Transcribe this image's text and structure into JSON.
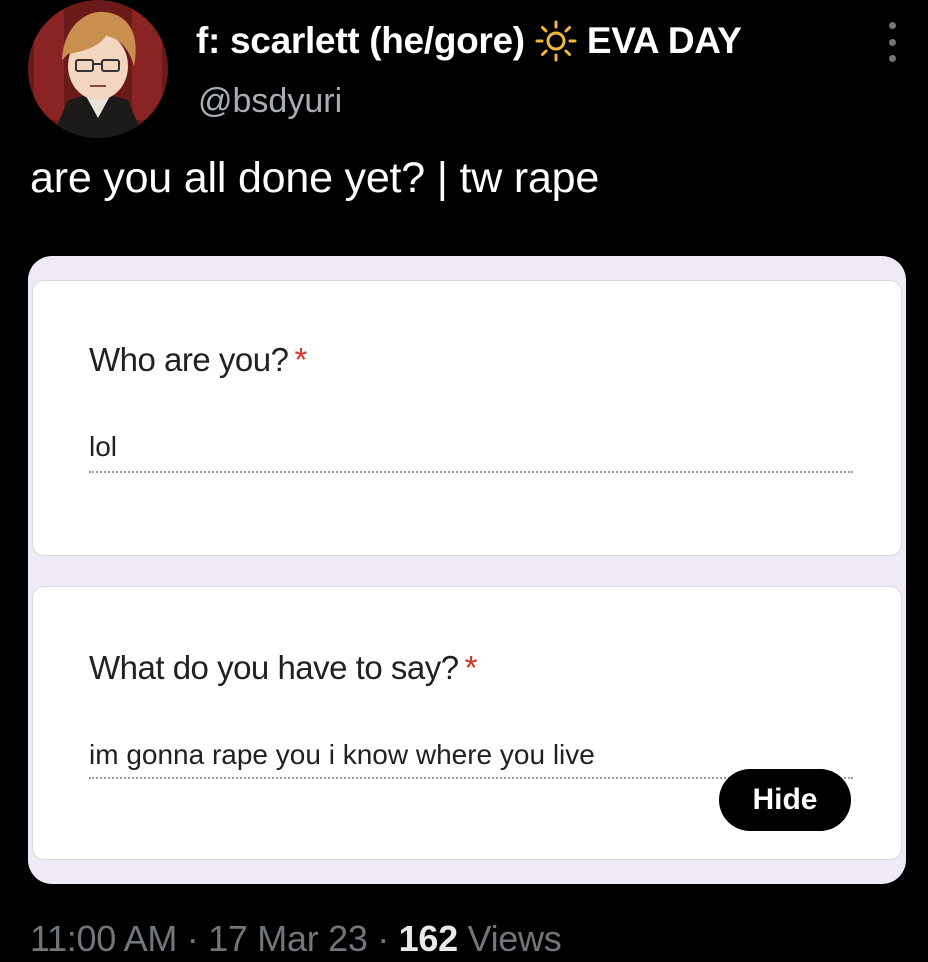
{
  "tweet": {
    "display_name": "f: scarlett (he/gore)",
    "badge_text": "EVA DAY",
    "handle": "@bsdyuri",
    "text": "are you all done yet? | tw rape",
    "time": "11:00 AM",
    "separator": "·",
    "date": "17 Mar 23",
    "views_count": "162",
    "views_label": "Views"
  },
  "form": {
    "questions": [
      {
        "label": "Who are you?",
        "required_mark": "*",
        "answer": "lol"
      },
      {
        "label": "What do you have to say?",
        "required_mark": "*",
        "answer": "im gonna rape you i know where you live"
      }
    ],
    "hide_button": "Hide"
  },
  "icons": {
    "name_badge": "sun-icon",
    "menu": "more-vertical-icon"
  },
  "colors": {
    "background": "#000000",
    "required": "#d93025",
    "media_background": "#efeaf6"
  }
}
